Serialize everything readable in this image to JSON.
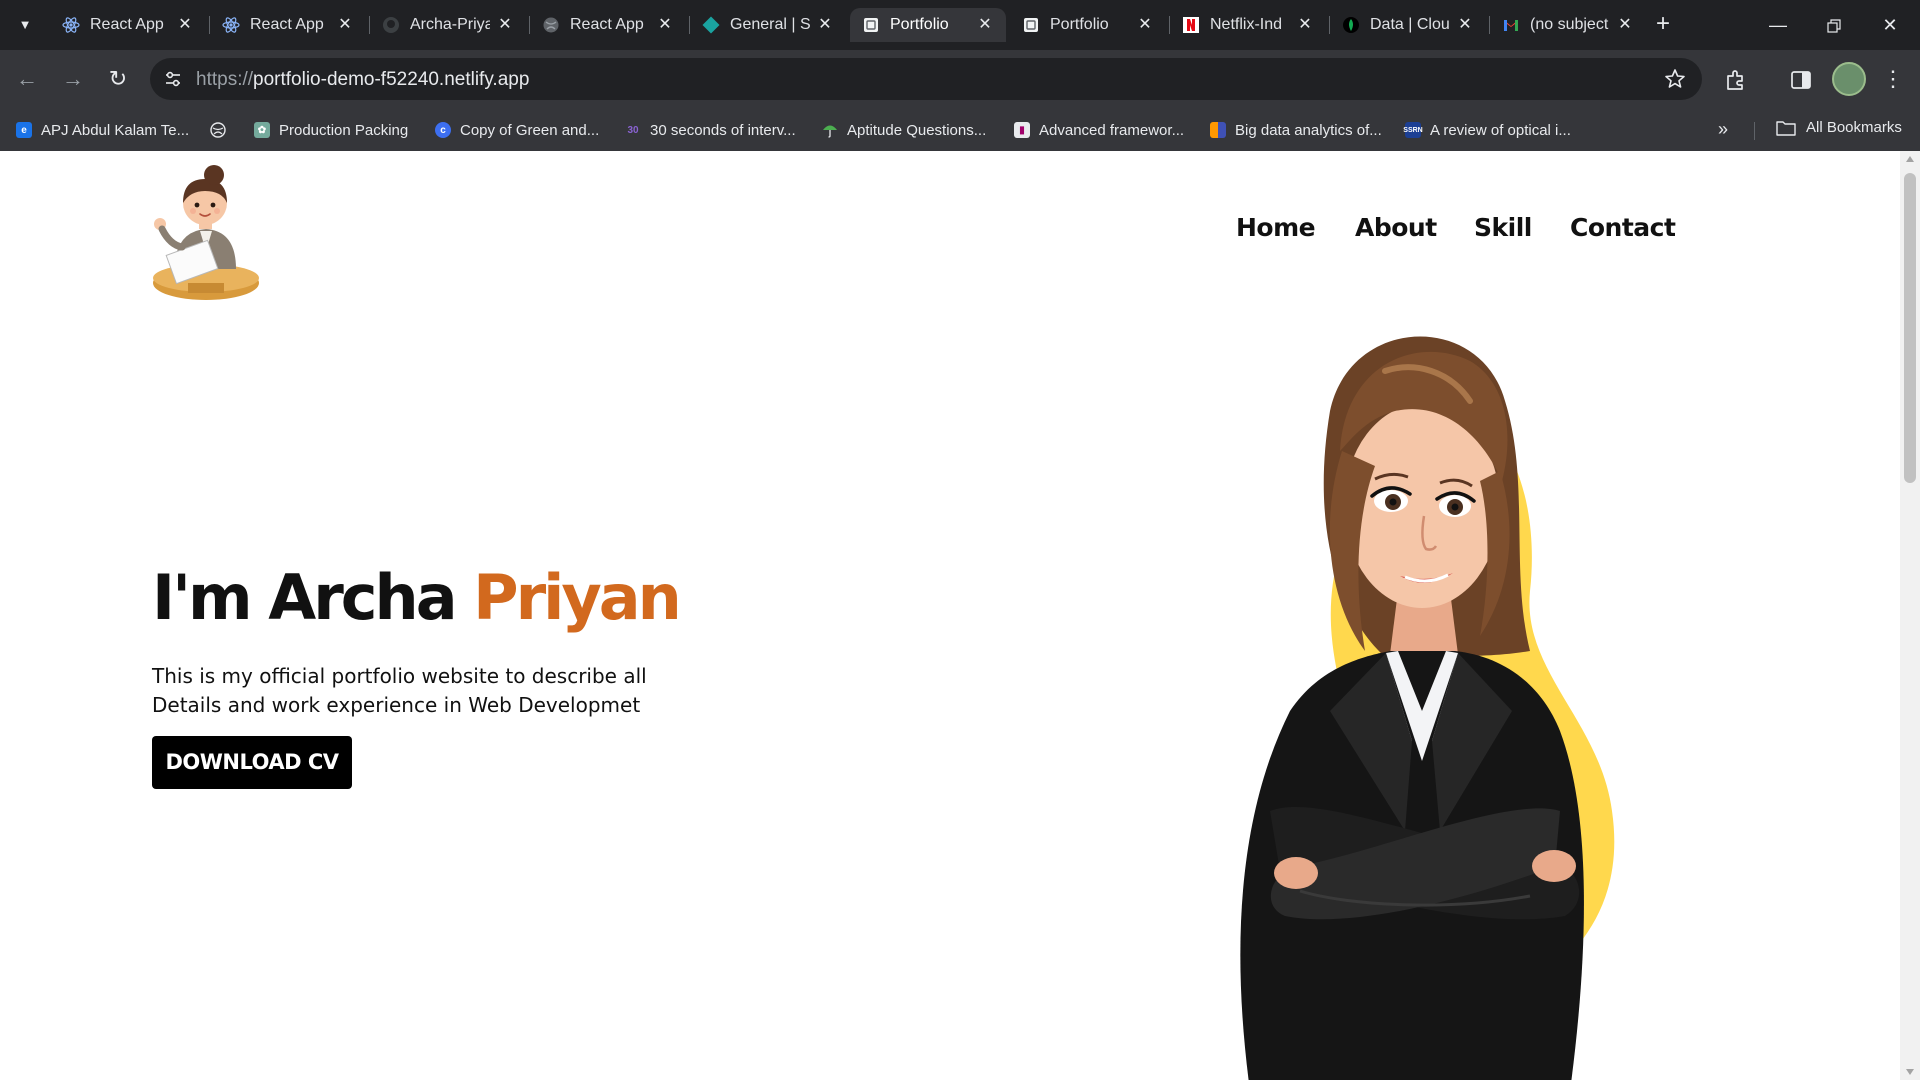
{
  "browser": {
    "tabs": [
      {
        "title": "React App",
        "favicon": "react-icon",
        "active": false
      },
      {
        "title": "React App",
        "favicon": "react-icon",
        "active": false
      },
      {
        "title": "Archa-Priyan",
        "favicon": "github-icon",
        "active": false
      },
      {
        "title": "React App",
        "favicon": "globe-icon",
        "active": false
      },
      {
        "title": "General | S",
        "favicon": "diamond-icon",
        "active": false
      },
      {
        "title": "Portfolio",
        "favicon": "page-icon",
        "active": true
      },
      {
        "title": "Portfolio",
        "favicon": "page-icon",
        "active": false
      },
      {
        "title": "Netflix-Ind",
        "favicon": "netflix-icon",
        "active": false
      },
      {
        "title": "Data | Clou",
        "favicon": "leaf-icon",
        "active": false
      },
      {
        "title": "(no subject",
        "favicon": "gmail-icon",
        "active": false
      }
    ],
    "address_bar": {
      "scheme": "https://",
      "host": "portfolio-demo-f52240.netlify.app"
    },
    "bookmarks": [
      {
        "label": "APJ Abdul Kalam Te...",
        "icon": "edge-e-icon"
      },
      {
        "label": "",
        "icon": "globe-icon"
      },
      {
        "label": "Production Packing",
        "icon": "openai-icon"
      },
      {
        "label": "Copy of Green and...",
        "icon": "canva-icon"
      },
      {
        "label": "30 seconds of interv...",
        "icon": "30s-icon"
      },
      {
        "label": "Aptitude Questions...",
        "icon": "umbrella-icon"
      },
      {
        "label": "Advanced framewor...",
        "icon": "bar-icon"
      },
      {
        "label": "Big data analytics of...",
        "icon": "doc-icon"
      },
      {
        "label": "A review of optical i...",
        "icon": "ssrn-icon"
      }
    ],
    "all_bookmarks_label": "All Bookmarks",
    "colors": {
      "frame": "#202124",
      "toolbar": "#35363a"
    }
  },
  "page": {
    "nav": [
      "Home",
      "About",
      "Skill",
      "Contact"
    ],
    "hero": {
      "title_main": "I'm Archa ",
      "title_accent": "Priyan",
      "description": "This is my official portfolio website to describe all Details and work experience in Web Developmet",
      "cta_label": "DOWNLOAD CV"
    },
    "colors": {
      "accent": "#d2691e",
      "blob": "#ffd84d",
      "button": "#000000"
    }
  }
}
